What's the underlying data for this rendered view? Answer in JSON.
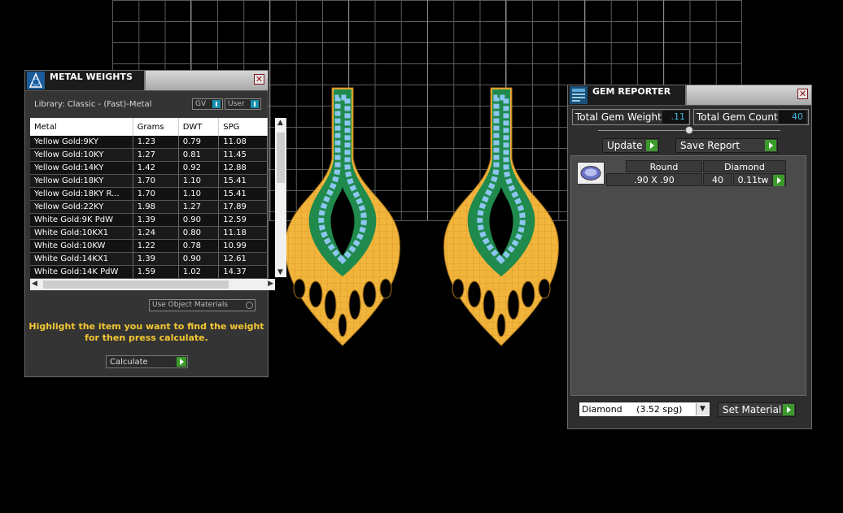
{
  "metal_weights": {
    "title": "METAL WEIGHTS",
    "library_label": "Library: Classic - (Fast)-Metal",
    "gv_label": "GV",
    "user_label": "User",
    "columns": [
      "Metal",
      "Grams",
      "DWT",
      "SPG"
    ],
    "rows": [
      [
        "Yellow Gold:9KY",
        "1.23",
        "0.79",
        "11.08"
      ],
      [
        "Yellow Gold:10KY",
        "1.27",
        "0.81",
        "11.45"
      ],
      [
        "Yellow Gold:14KY",
        "1.42",
        "0.92",
        "12.88"
      ],
      [
        "Yellow Gold:18KY",
        "1.70",
        "1.10",
        "15.41"
      ],
      [
        "Yellow Gold:18KY R...",
        "1.70",
        "1.10",
        "15.41"
      ],
      [
        "Yellow Gold:22KY",
        "1.98",
        "1.27",
        "17.89"
      ],
      [
        "White Gold:9K PdW",
        "1.39",
        "0.90",
        "12.59"
      ],
      [
        "White Gold:10KX1",
        "1.24",
        "0.80",
        "11.18"
      ],
      [
        "White Gold:10KW",
        "1.22",
        "0.78",
        "10.99"
      ],
      [
        "White Gold:14KX1",
        "1.39",
        "0.90",
        "12.61"
      ],
      [
        "White Gold:14K PdW",
        "1.59",
        "1.02",
        "14.37"
      ]
    ],
    "use_object_materials": "Use Object Materials",
    "hint": "Highlight the item you want to find the weight for then press calculate.",
    "calculate_label": "Calculate"
  },
  "gem_reporter": {
    "title": "GEM REPORTER",
    "total_weight_label": "Total Gem Weight",
    "total_weight_value": ".11",
    "total_count_label": "Total Gem Count",
    "total_count_value": "40",
    "update_label": "Update",
    "save_report_label": "Save Report",
    "gem": {
      "shape": "Round",
      "size": ".90 X .90",
      "material": "Diamond",
      "count": "40",
      "weight": "0.11tw"
    },
    "material_select": "Diamond     (3.52 spg)",
    "set_material_label": "Set Material"
  },
  "icons": [
    "close-icon",
    "app-logo-icon",
    "gem-reporter-icon",
    "play-icon",
    "diamond-gem-icon",
    "dropdown-arrow-icon"
  ],
  "colors": {
    "gold": "#f2b53c",
    "green": "#1e8a4a",
    "gem_blue": "#7eb6e8",
    "accent_hint": "#f4c832",
    "value_blue": "#3fb8e0"
  }
}
